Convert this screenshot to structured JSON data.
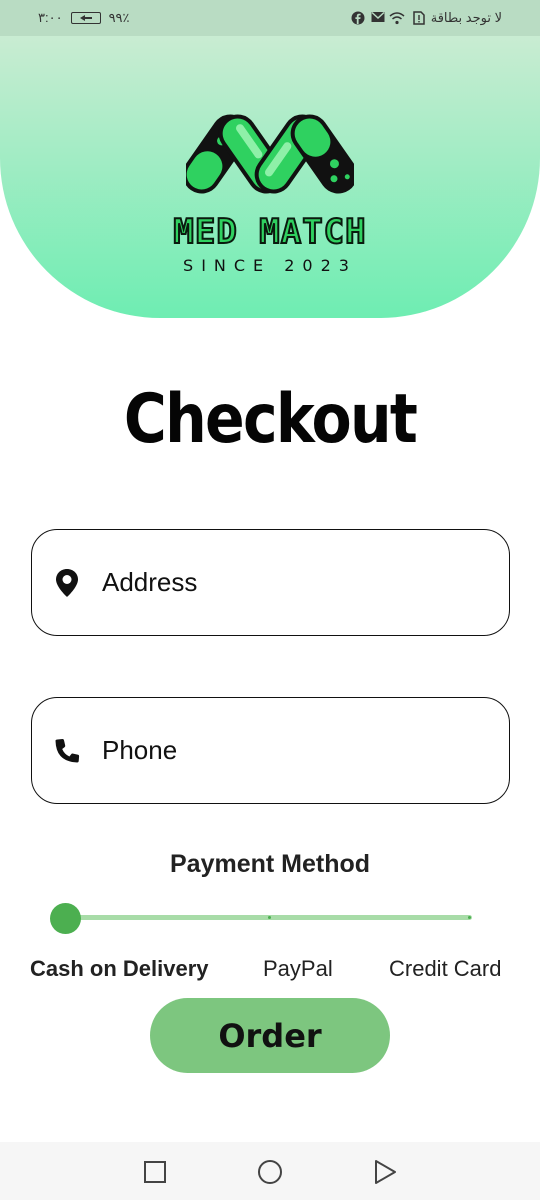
{
  "status_bar": {
    "time": "٣:٠٠",
    "battery_percent": "٩٩٪",
    "carrier": "لا توجد بطاقة"
  },
  "header": {
    "brand_name": "MED MATCH",
    "tagline": "SINCE 2023",
    "gradient_top": "#c9ecd2",
    "gradient_bottom": "#6eedb2"
  },
  "page": {
    "title": "Checkout"
  },
  "form": {
    "address": {
      "placeholder": "Address",
      "icon": "location-pin-icon"
    },
    "phone": {
      "placeholder": "Phone",
      "icon": "phone-icon"
    }
  },
  "payment": {
    "title": "Payment Method",
    "options": [
      "Cash on Delivery",
      "PayPal",
      "Credit Card"
    ],
    "selected_index": 0,
    "accent_color": "#4caf50"
  },
  "order_button": {
    "label": "Order",
    "color": "#7dc67f"
  },
  "nav": {
    "icons": [
      "square-icon",
      "circle-icon",
      "triangle-icon"
    ]
  }
}
